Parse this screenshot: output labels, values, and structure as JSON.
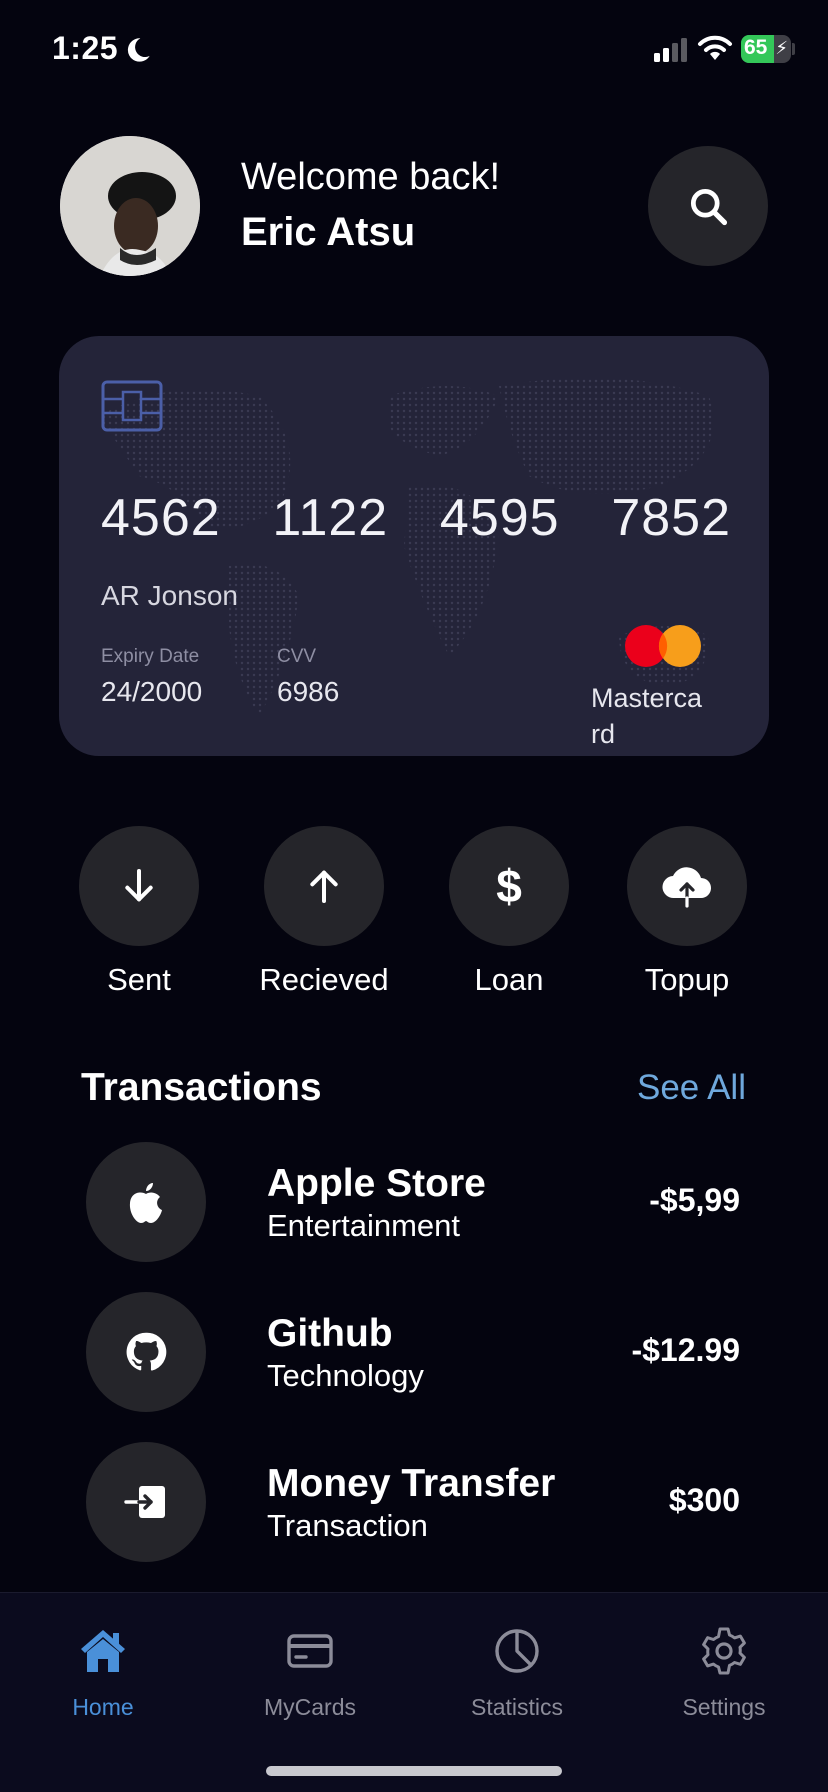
{
  "status_bar": {
    "time": "1:25",
    "battery": "65",
    "battery_level": 0.65
  },
  "header": {
    "welcome": "Welcome back!",
    "name": "Eric Atsu"
  },
  "card": {
    "number_groups": [
      "4562",
      "1122",
      "4595",
      "7852"
    ],
    "holder": "AR Jonson",
    "expiry_label": "Expiry Date",
    "expiry_value": "24/2000",
    "cvv_label": "CVV",
    "cvv_value": "6986",
    "network": "Mastercard"
  },
  "actions": [
    {
      "label": "Sent",
      "icon": "arrow-down-icon"
    },
    {
      "label": "Recieved",
      "icon": "arrow-up-icon"
    },
    {
      "label": "Loan",
      "icon": "dollar-icon"
    },
    {
      "label": "Topup",
      "icon": "cloud-upload-icon"
    }
  ],
  "transactions": {
    "title": "Transactions",
    "see_all": "See All",
    "items": [
      {
        "name": "Apple Store",
        "category": "Entertainment",
        "amount": "-$5,99",
        "icon": "apple-icon"
      },
      {
        "name": "Github",
        "category": "Technology",
        "amount": "-$12.99",
        "icon": "github-icon"
      },
      {
        "name": "Money Transfer",
        "category": "Transaction",
        "amount": "$300",
        "icon": "transfer-in-icon"
      }
    ]
  },
  "nav": {
    "items": [
      {
        "label": "Home",
        "icon": "home-icon",
        "active": true
      },
      {
        "label": "MyCards",
        "icon": "card-icon",
        "active": false
      },
      {
        "label": "Statistics",
        "icon": "pie-chart-icon",
        "active": false
      },
      {
        "label": "Settings",
        "icon": "gear-icon",
        "active": false
      }
    ]
  },
  "colors": {
    "background": "#04040f",
    "card": "#242439",
    "circle_button": "#25252a",
    "accent": "#4a90d9",
    "see_all": "#6fa8dc",
    "mastercard_red": "#eb001b",
    "mastercard_orange": "#f79e1b"
  }
}
